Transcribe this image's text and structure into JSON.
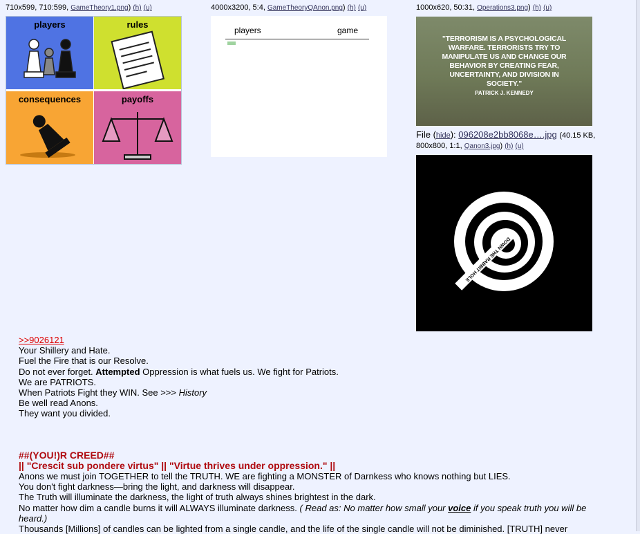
{
  "posts": [
    {
      "meta_prefix": "710x599, 710:599, ",
      "filename": "GameTheory1.png",
      "hide_h": "(h)",
      "hide_u": "(u)",
      "cells": [
        {
          "label": "players",
          "color": "#4f73e3"
        },
        {
          "label": "rules",
          "color": "#cfe02f"
        },
        {
          "label": "consequences",
          "color": "#f8a534"
        },
        {
          "label": "payoffs",
          "color": "#d7649e"
        }
      ]
    },
    {
      "meta_prefix": "4000x3200, 5:4, ",
      "filename": "GameTheoryQAnon.png",
      "hide_h": "(h)",
      "hide_u": "(u)",
      "header_left": "players",
      "header_right": "game"
    },
    {
      "meta_prefix": "1000x620, 50:31, ",
      "filename": "Operations3.png",
      "hide_h": "(h)",
      "hide_u": "(u)",
      "quote_text": "\"TERRORISM IS A PSYCHOLOGICAL WARFARE. TERRORISTS TRY TO MANIPULATE US AND CHANGE OUR BEHAVIOR BY CREATING FEAR, UNCERTAINTY, AND DIVISION IN SOCIETY.\"",
      "quote_author": "PATRICK J. KENNEDY"
    }
  ],
  "file2": {
    "label": "File",
    "hide": "hide",
    "filename": "096208e2bb8068e….jpg",
    "info": "(40.15 KB, ",
    "info2": "800x800, 1:1, ",
    "link": "Qanon3.jpg",
    "hide_h": "(h)",
    "hide_u": "(u)",
    "rabbit_text": "DOWN THE RABBIT HOLE"
  },
  "message": {
    "quote_link": ">>9026121",
    "lines_a": [
      "Your Shillery and Hate.",
      "Fuel the Fire that is our Resolve."
    ],
    "line_attempted_pre": "Do not ever forget. ",
    "line_attempted_bold": "Attempted",
    "line_attempted_post": " Oppression is what fuels us. We fight for Patriots.",
    "line_patriots": "We are PATRIOTS.",
    "line_history_pre": "When Patriots Fight they WIN. See >>> ",
    "line_history_em": "History",
    "lines_b": [
      "Be well read Anons.",
      "They want you divided."
    ],
    "creed_title": "##(YOU!)R CREED##",
    "creed_motto": "|| \"Crescit sub pondere virtus\" || \"Virtue thrives under oppression.\" ||",
    "lines_c": [
      "Anons we must join TOGETHER to tell the TRUTH. WE are fighting a MONSTER of Darnkess who knows nothing but LIES.",
      "You don't fight darkness—bring the light, and darkness will disappear.",
      "The Truth will illuminate the darkness, the light of truth always shines brightest in the dark."
    ],
    "candle_pre": "No matter how dim a candle burns it will ALWAYS illuminate darkness. ",
    "candle_em1": "( Read as: No matter how small your ",
    "candle_voice": "voice",
    "candle_em2": " if you speak truth you will be",
    "candle_em3": "heard.)",
    "last_line": "Thousands [Millions] of candles can be lighted from a single candle, and the life of the single candle will not be diminished. [TRUTH] never"
  }
}
